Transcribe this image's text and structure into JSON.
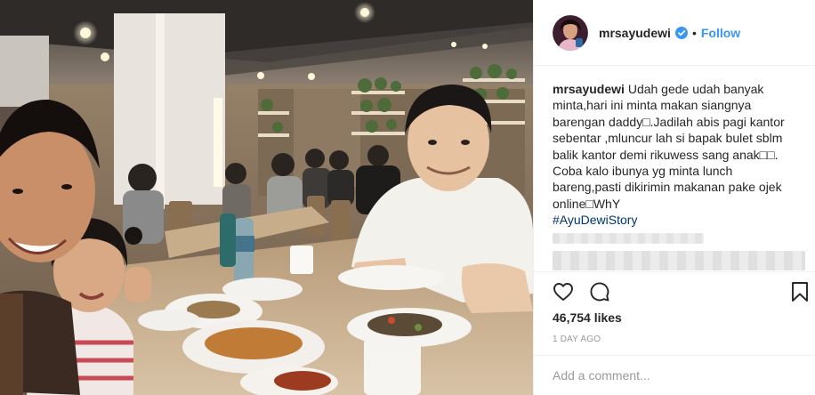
{
  "post": {
    "author": {
      "username": "mrsayudewi",
      "verified": true,
      "avatar_icon": "profile-avatar",
      "follow_label": "Follow",
      "separator": "•"
    },
    "caption": {
      "username": "mrsayudewi",
      "lines": [
        "Udah gede udah banyak",
        "minta,hari ini minta makan siangnya",
        "barengan daddy□.Jadilah abis pagi kantor",
        "sebentar ,mluncur lah si bapak bulet sblm",
        "balik kantor demi rikuwess sang anak□□.",
        "Coba kalo ibunya yg minta lunch",
        "bareng,pasti dikirimin makanan pake ojek",
        "online□WhY"
      ],
      "hashtag": "#AyuDewiStory"
    },
    "actions": {
      "like_icon": "heart-icon",
      "comment_icon": "comment-bubble-icon",
      "save_icon": "bookmark-icon"
    },
    "likes_text": "46,754 likes",
    "timestamp": "1 DAY AGO",
    "comment_field": {
      "placeholder": "Add a comment...",
      "value": ""
    },
    "colors": {
      "follow_blue": "#3897f0",
      "hashtag_blue": "#003569",
      "verified_blue": "#3897f0",
      "muted_grey": "#999999",
      "text": "#262626"
    }
  }
}
